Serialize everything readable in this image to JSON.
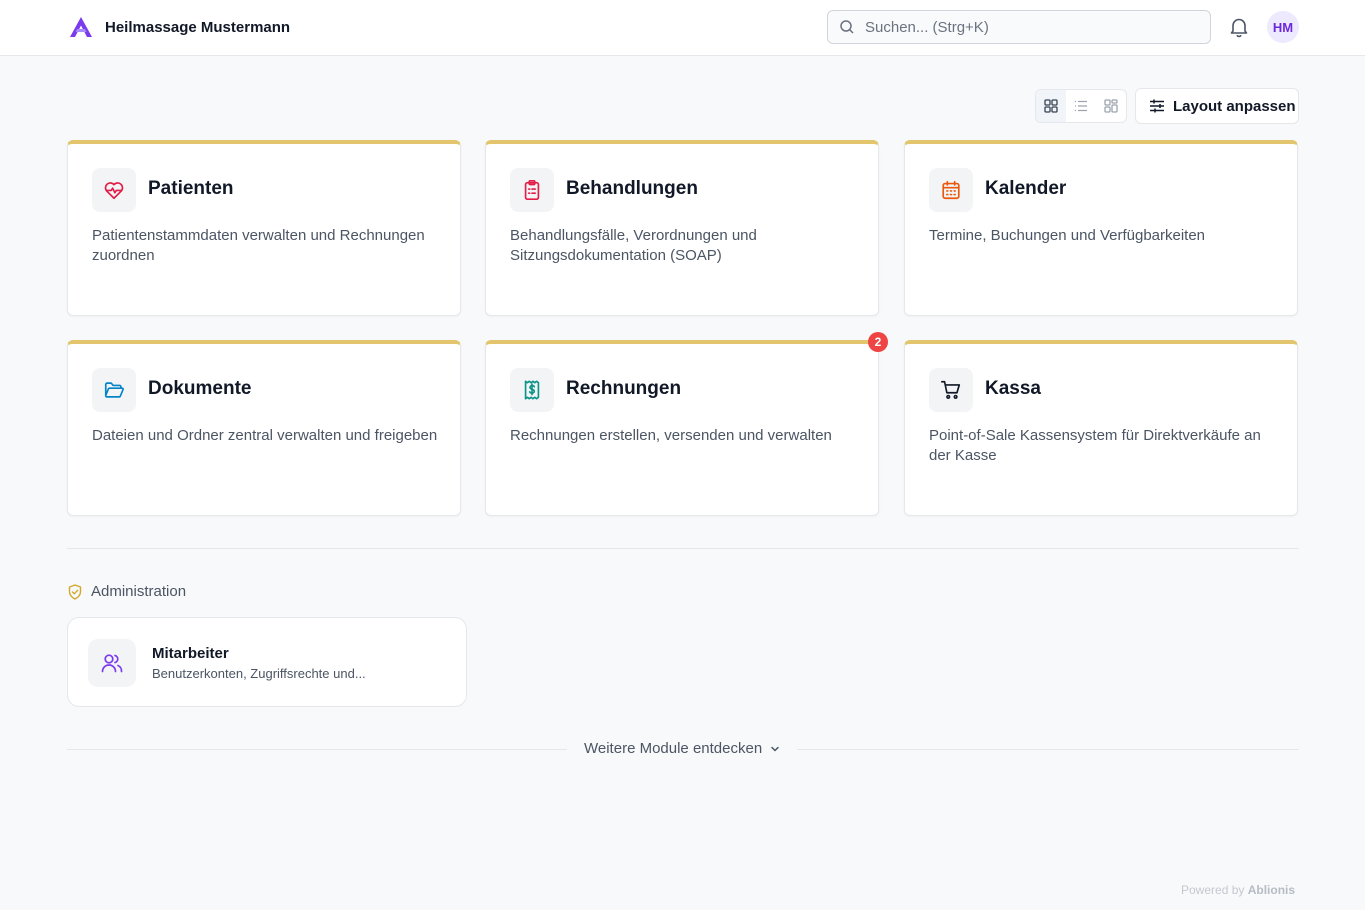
{
  "header": {
    "company_name": "Heilmassage Mustermann",
    "search_placeholder": "Suchen... (Strg+K)",
    "user_initials": "HM"
  },
  "toolbar": {
    "view_modes": [
      "grid",
      "list",
      "compact"
    ],
    "active_view": "grid",
    "layout_button_label": "Layout anpassen"
  },
  "modules": [
    {
      "title": "Patienten",
      "description": "Patientenstammdaten verwalten und Rechnungen zuordnen",
      "icon": "heart-pulse-icon",
      "icon_color": "#e11d48"
    },
    {
      "title": "Behandlungen",
      "description": "Behandlungsfälle, Verordnungen und Sitzungsdokumentation (SOAP)",
      "icon": "clipboard-list-icon",
      "icon_color": "#e11d48"
    },
    {
      "title": "Kalender",
      "description": "Termine, Buchungen und Verfügbarkeiten",
      "icon": "calendar-icon",
      "icon_color": "#ea580c"
    },
    {
      "title": "Dokumente",
      "description": "Dateien und Ordner zentral verwalten und freigeben",
      "icon": "folder-open-icon",
      "icon_color": "#0284c7"
    },
    {
      "title": "Rechnungen",
      "description": "Rechnungen erstellen, versenden und verwalten",
      "icon": "receipt-icon",
      "icon_color": "#0d9488",
      "badge": "2"
    },
    {
      "title": "Kassa",
      "description": "Point-of-Sale Kassensystem für Direktverkäufe an der Kasse",
      "icon": "shopping-cart-icon",
      "icon_color": "#111827"
    }
  ],
  "administration": {
    "section_label": "Administration",
    "items": [
      {
        "title": "Mitarbeiter",
        "description": "Benutzerkonten, Zugriffsrechte und...",
        "icon": "users-icon",
        "icon_color": "#7c3aed"
      }
    ]
  },
  "more_modules_label": "Weitere Module entdecken",
  "footer": {
    "powered_prefix": "Powered by",
    "powered_brand": "Ablionis"
  },
  "colors": {
    "accent_bar": "#e2c56d",
    "brand": "#7c3aed",
    "badge": "#ef4444"
  }
}
